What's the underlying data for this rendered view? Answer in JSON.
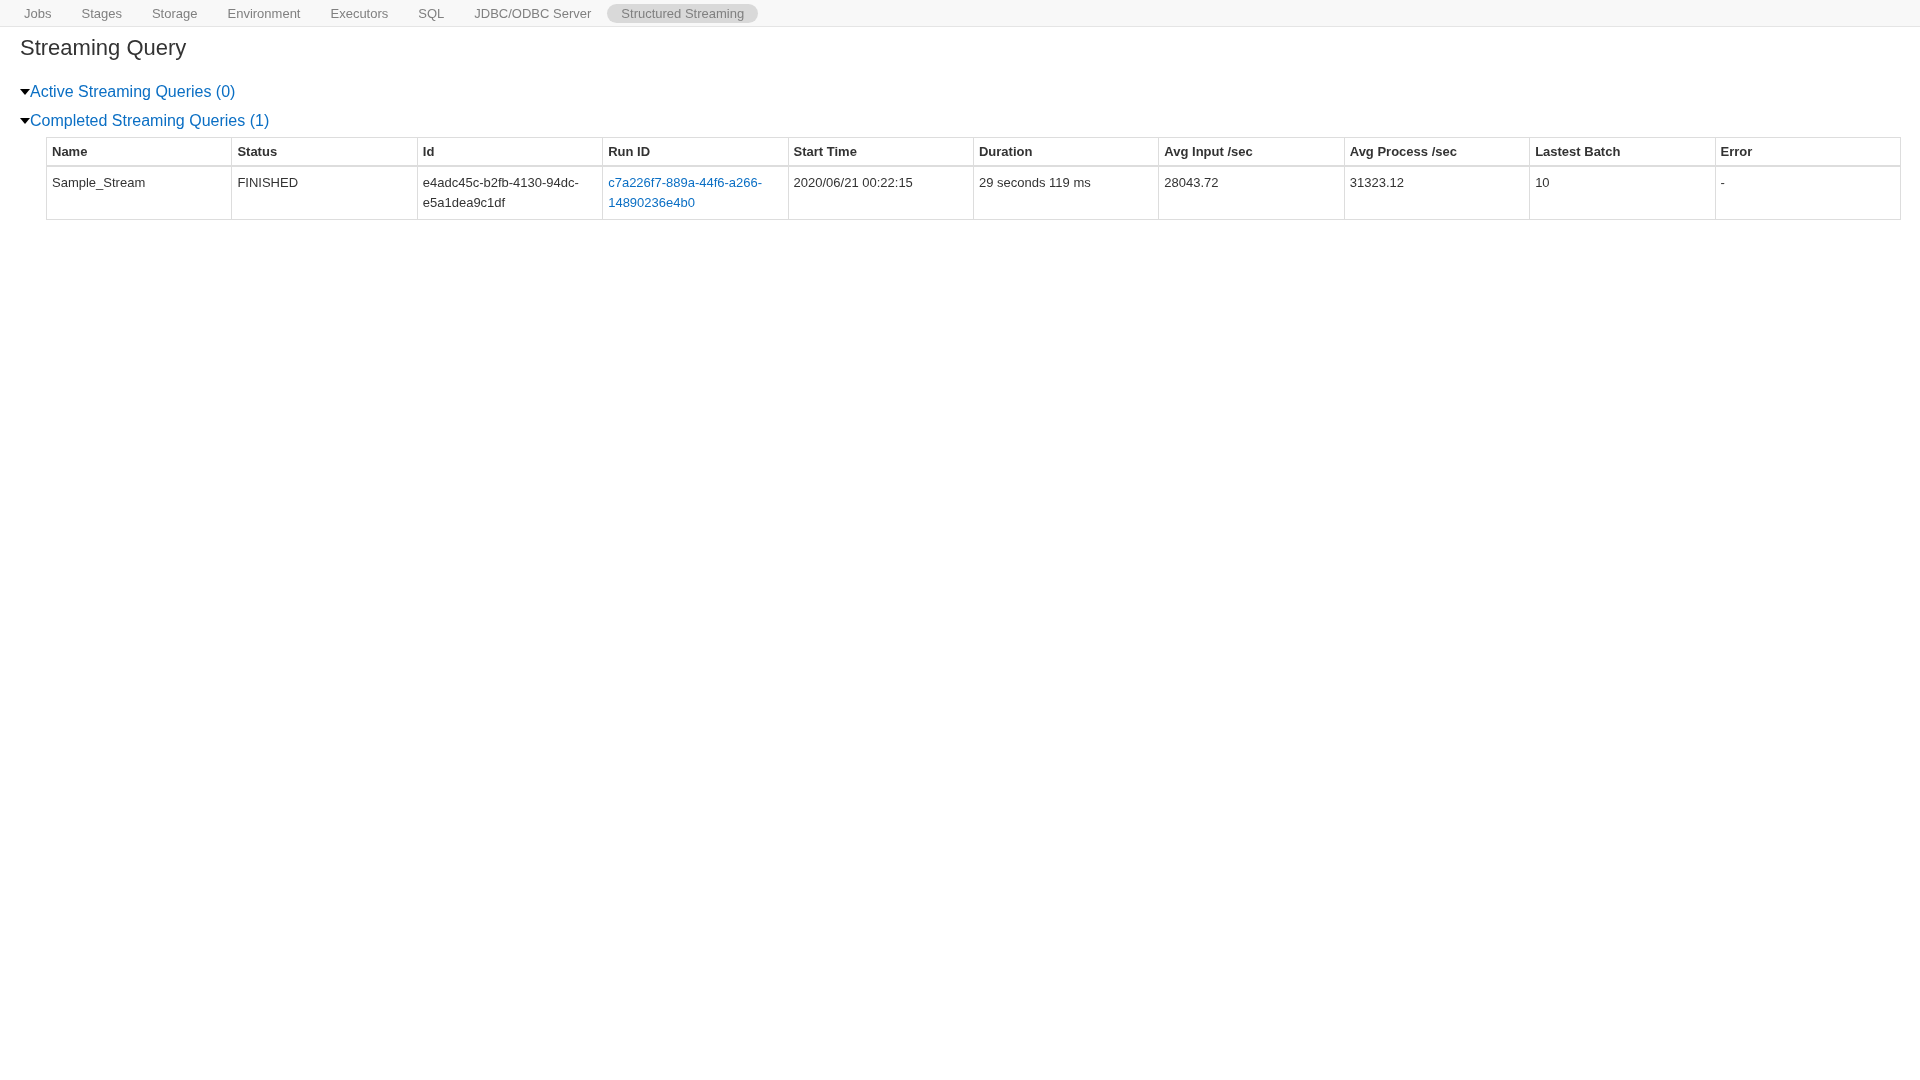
{
  "nav_tabs": [
    {
      "label": "Jobs",
      "selected": false
    },
    {
      "label": "Stages",
      "selected": false
    },
    {
      "label": "Storage",
      "selected": false
    },
    {
      "label": "Environment",
      "selected": false
    },
    {
      "label": "Executors",
      "selected": false
    },
    {
      "label": "SQL",
      "selected": false
    },
    {
      "label": "JDBC/ODBC Server",
      "selected": false
    },
    {
      "label": "Structured Streaming",
      "selected": true
    }
  ],
  "page_title": "Streaming Query",
  "sections": [
    {
      "title": "Active Streaming Queries (0)",
      "expanded": true
    },
    {
      "title": "Completed Streaming Queries (1)",
      "expanded": true
    }
  ],
  "table": {
    "columns": [
      "Name",
      "Status",
      "Id",
      "Run ID",
      "Start Time",
      "Duration",
      "Avg Input /sec",
      "Avg Process /sec",
      "Lastest Batch",
      "Error"
    ],
    "rows": [
      {
        "cells": [
          {
            "text": "Sample_Stream",
            "kind": "text"
          },
          {
            "text": "FINISHED",
            "kind": "text"
          },
          {
            "text": "e4adc45c-b2fb-4130-94dc-e5a1dea9c1df",
            "kind": "text"
          },
          {
            "text": "c7a226f7-889a-44f6-a266-14890236e4b0",
            "kind": "link"
          },
          {
            "text": "2020/06/21 00:22:15",
            "kind": "text"
          },
          {
            "text": "29 seconds 119 ms",
            "kind": "text"
          },
          {
            "text": "28043.72",
            "kind": "text"
          },
          {
            "text": "31323.12",
            "kind": "text"
          },
          {
            "text": "10",
            "kind": "text"
          },
          {
            "text": "-",
            "kind": "text"
          }
        ]
      }
    ]
  }
}
